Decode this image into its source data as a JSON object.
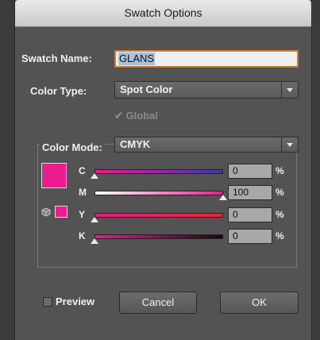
{
  "window": {
    "title": "Swatch Options"
  },
  "swatch_name": {
    "label": "Swatch Name:",
    "value": "GLANS"
  },
  "color_type": {
    "label": "Color Type:",
    "value": "Spot Color"
  },
  "global": {
    "label": "Global",
    "checked": true,
    "enabled": false
  },
  "color_mode": {
    "label": "Color Mode:",
    "value": "CMYK"
  },
  "swatch_color": "#ec1c8e",
  "sliders": [
    {
      "letter": "C",
      "value": "0",
      "unit": "%",
      "gradient": [
        "#e91d8d",
        "#3b3aa8"
      ],
      "thumb_fraction": 0.0
    },
    {
      "letter": "M",
      "value": "100",
      "unit": "%",
      "gradient": [
        "#ffffff",
        "#e91d8d"
      ],
      "thumb_fraction": 1.0
    },
    {
      "letter": "Y",
      "value": "0",
      "unit": "%",
      "gradient": [
        "#e91d8d",
        "#ee2430"
      ],
      "thumb_fraction": 0.0
    },
    {
      "letter": "K",
      "value": "0",
      "unit": "%",
      "gradient": [
        "#e91d8d",
        "#120a10"
      ],
      "thumb_fraction": 0.0
    }
  ],
  "preview": {
    "label": "Preview",
    "checked": false
  },
  "buttons": {
    "cancel": "Cancel",
    "ok": "OK"
  }
}
